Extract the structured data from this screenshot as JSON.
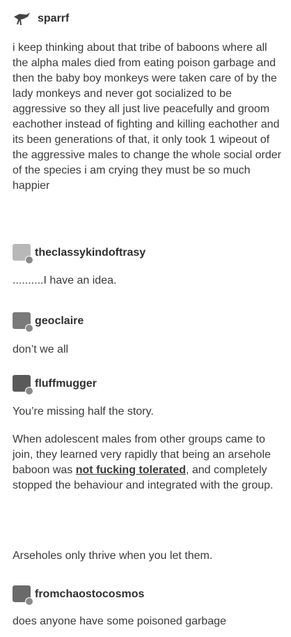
{
  "posts": [
    {
      "username": "sparrf",
      "avatar_icon": "bird-icon",
      "paragraphs": [
        "i keep thinking about that tribe of baboons where all the alpha males died from eating poison garbage and then the baby boy monkeys were taken care of by the lady monkeys and never got socialized to be aggressive so they all just live peacefully and groom eachother instead of fighting and killing eachother and its been generations of that, it only took 1 wipeout of the aggressive males to change the whole social order of the species i am crying they must be so much happier"
      ]
    },
    {
      "username": "theclassykindoftrasy",
      "avatar_icon": "user-avatar-icon",
      "paragraphs": [
        "..........I have an idea."
      ]
    },
    {
      "username": "geoclaire",
      "avatar_icon": "user-avatar-icon",
      "paragraphs": [
        "don’t we all"
      ]
    },
    {
      "username": "fluffmugger",
      "avatar_icon": "user-avatar-icon",
      "paragraphs": [
        "You’re missing half the story.",
        "When adolescent males from other groups came to join, they learned very rapidly that being an arsehole baboon was",
        "not fucking tolerated",
        ", and completely stopped the behaviour and integrated with the group.",
        "Arseholes only thrive when you let them."
      ]
    },
    {
      "username": "fromchaostocosmos",
      "avatar_icon": "user-avatar-icon",
      "paragraphs": [
        "does anyone have some poisoned garbage"
      ]
    }
  ]
}
